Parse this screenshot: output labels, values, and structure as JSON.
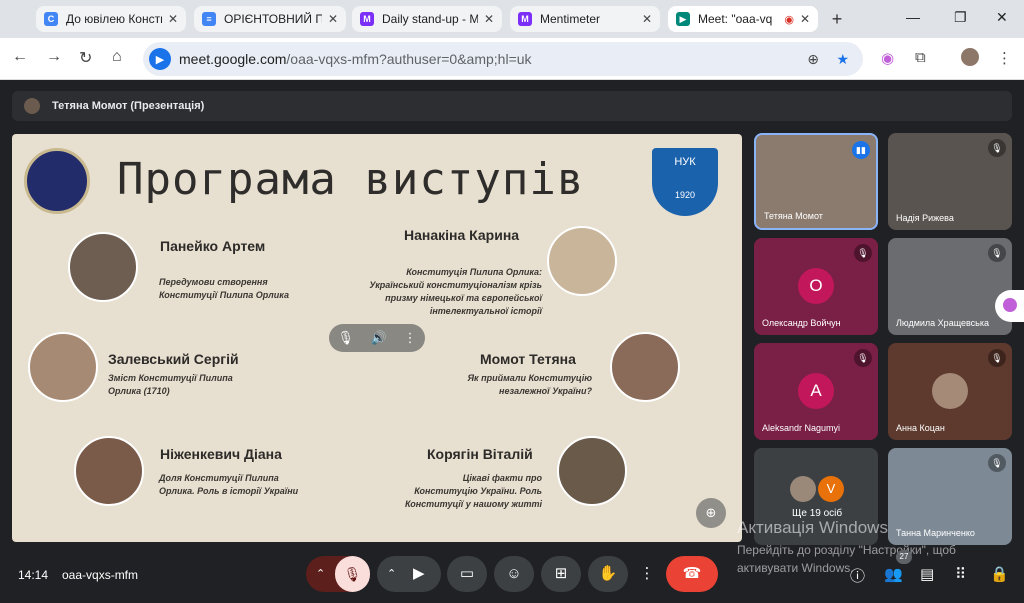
{
  "browser": {
    "tabs": [
      {
        "title": "До ювілею Консти",
        "fav_color": "#4285f4",
        "fav_glyph": "C"
      },
      {
        "title": "ОРІЄНТОВНИЙ ПЛ",
        "fav_color": "#4285f4",
        "fav_glyph": "≡"
      },
      {
        "title": "Daily stand-up - M",
        "fav_color": "#7b2ff7",
        "fav_glyph": "M"
      },
      {
        "title": "Mentimeter",
        "fav_color": "#7b2ff7",
        "fav_glyph": "M"
      },
      {
        "title": "Meet: \"oaa-vq",
        "fav_color": "#00897b",
        "fav_glyph": "▶"
      }
    ],
    "url_host": "meet.google.com",
    "url_rest": "/oaa-vqxs-mfm?authuser=0&amp;hl=uk"
  },
  "presentation": {
    "presenter_label": "Тетяна Момот (Презентація)",
    "slide_title": "Програма виступів",
    "logo_right_text": "НУК",
    "logo_right_year": "1920",
    "speakers": [
      {
        "name": "Панейко Артем",
        "topic_l1": "Передумови створення",
        "topic_l2": "Конституції Пилипа Орлика"
      },
      {
        "name": "Нанакіна Карина",
        "topic_l1": "Конституція Пилипа Орлика:",
        "topic_l2": "Український конституціоналізм крізь",
        "topic_l3": "призму німецької та європейської",
        "topic_l4": "інтелектуальної історії"
      },
      {
        "name": "Залевський Сергій",
        "topic_l1": "Зміст Конституції Пилипа",
        "topic_l2": "Орлика (1710)"
      },
      {
        "name": "Момот Тетяна",
        "topic_l1": "Як приймали Конституцію",
        "topic_l2": "незалежної України?"
      },
      {
        "name": "Ніженкевич Діана",
        "topic_l1": "Доля Конституції Пилипа",
        "topic_l2": "Орлика. Роль в історії України"
      },
      {
        "name": "Корягін Віталій",
        "topic_l1": "Цікаві факти про",
        "topic_l2": "Конституцію України. Роль",
        "topic_l3": "Конституції у нашому житті"
      }
    ]
  },
  "participants": [
    {
      "name": "Тетяна Момот",
      "bg": "#8b7b6e"
    },
    {
      "name": "Надія Рижева",
      "bg": "#5a5450"
    },
    {
      "name": "Олександр Войчун",
      "bg": "#7a1f46",
      "initial": "О",
      "avatar_color": "#c2185b"
    },
    {
      "name": "Людмила Хращевська",
      "bg": "#6b6c70"
    },
    {
      "name": "Aleksandr Nagumyi",
      "bg": "#7a1f46",
      "initial": "A",
      "avatar_color": "#c2185b"
    },
    {
      "name": "Анна Коцан",
      "bg": "#5e3a2e"
    },
    {
      "more_label": "Ще 19 осіб",
      "initial": "V",
      "avatar_color": "#e8710a"
    },
    {
      "name": "Танна Маринченко",
      "bg": "#7d8a96"
    }
  ],
  "bottom": {
    "time": "14:14",
    "meeting_code": "oaa-vqxs-mfm",
    "people_count": "27"
  },
  "watermark": {
    "line1": "Активація Windows",
    "line2": "Перейдіть до розділу \"Настройки\", щоб",
    "line3": "активувати Windows."
  },
  "colors": {
    "end_call": "#ea4335",
    "mic_off": "#f9dedc"
  }
}
